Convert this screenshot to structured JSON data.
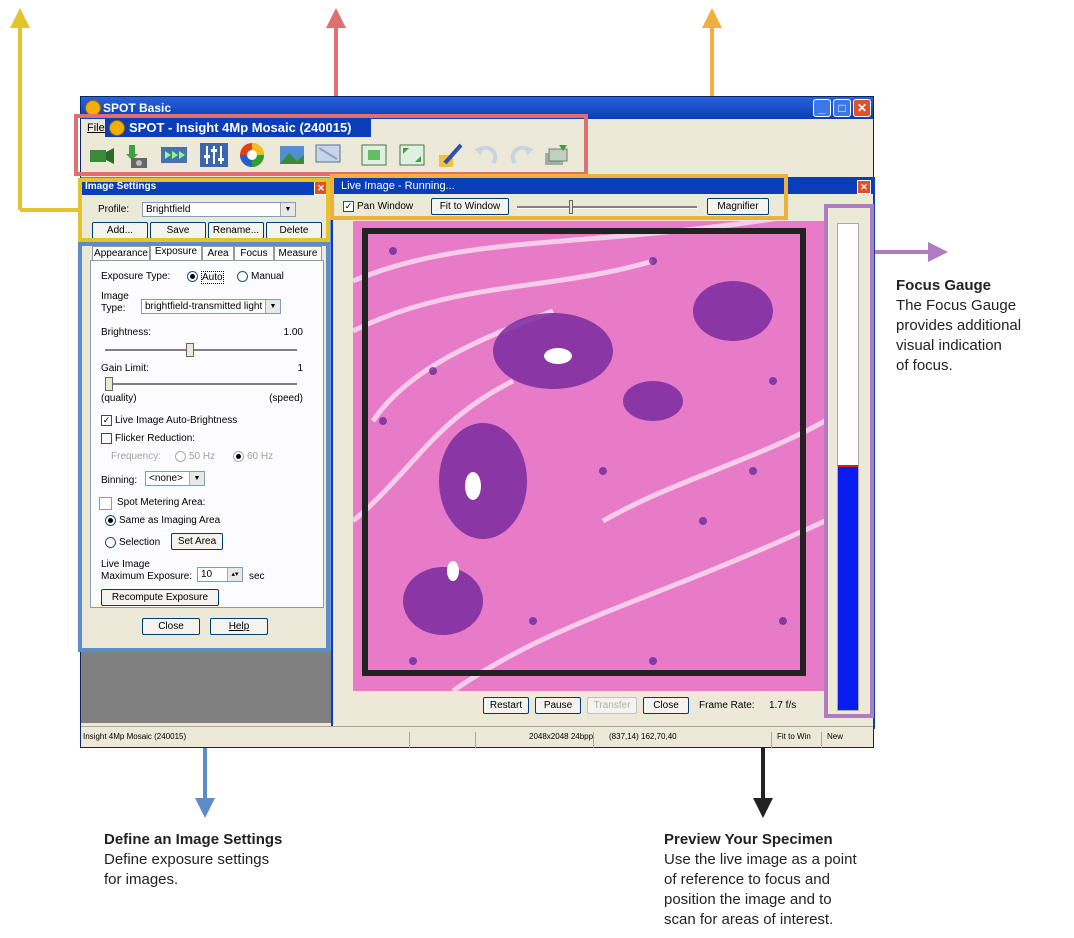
{
  "window": {
    "app_title": "SPOT Basic",
    "menu_file": "File",
    "doc_title": "SPOT - Insight 4Mp Mosaic (240015)",
    "minimize": "_",
    "maximize": "□",
    "close": "✕"
  },
  "toolbar": {
    "icons": [
      "video-camera-icon",
      "download-camera-icon",
      "filmstrip-icon",
      "sliders-icon",
      "color-wheel-icon",
      "image-icon",
      "monitor-icon",
      "fit-icon",
      "fullscreen-icon",
      "edit-icon",
      "undo-icon",
      "redo-icon",
      "stack-icon"
    ]
  },
  "image_settings": {
    "title": "Image Settings",
    "profile_label": "Profile:",
    "profile_value": "Brightfield",
    "buttons": [
      "Add...",
      "Save",
      "Rename...",
      "Delete"
    ],
    "tabs": [
      "Appearance",
      "Exposure",
      "Area",
      "Focus",
      "Measure"
    ],
    "exposure_type_label": "Exposure Type:",
    "exposure_auto": "Auto",
    "exposure_manual": "Manual",
    "image_type_label": "Image",
    "image_type_label2": "Type:",
    "image_type_value": "brightfield-transmitted light",
    "brightness_label": "Brightness:",
    "brightness_value": "1.00",
    "brightness_level": 0.5,
    "gain_label": "Gain Limit:",
    "gain_value": "1",
    "gain_level": 0.0,
    "gain_left": "(quality)",
    "gain_right": "(speed)",
    "live_auto_brightness": "Live Image Auto-Brightness",
    "flicker_reduction": "Flicker Reduction:",
    "frequency_label": "Frequency:",
    "freq_50": "50 Hz",
    "freq_60": "60 Hz",
    "binning_label": "Binning:",
    "binning_value": "<none>",
    "spot_metering": "Spot Metering Area:",
    "same_as_imaging": "Same as Imaging Area",
    "selection": "Selection",
    "set_area": "Set Area",
    "live_image_label": "Live Image",
    "max_exposure_label": "Maximum Exposure:",
    "max_exposure_value": "10",
    "max_exposure_unit": "sec",
    "recompute": "Recompute Exposure",
    "close": "Close",
    "help": "Help"
  },
  "live_image": {
    "title": "Live Image - Running...",
    "pan_window": "Pan Window",
    "fit_to_window": "Fit to Window",
    "magnifier": "Magnifier",
    "restart": "Restart",
    "pause": "Pause",
    "transfer": "Transfer",
    "close": "Close",
    "frame_rate_label": "Frame Rate:",
    "frame_rate_value": "1.7 f/s",
    "focus_level": 0.5
  },
  "status_bar": {
    "camera": "Insight 4Mp Mosaic (240015)",
    "dimensions": "2048x2048 24bpp",
    "coords": "(837,14) 162,70,40",
    "fit": "Fit to Win",
    "state": "New"
  },
  "annotations": {
    "focus_title": "Focus Gauge",
    "focus_body": [
      "The Focus Gauge",
      "provides additional",
      "visual indication",
      "of focus."
    ],
    "settings_title": "Define an Image Settings",
    "settings_body": [
      "Define exposure settings",
      "for images."
    ],
    "preview_title": "Preview Your Specimen",
    "preview_body": [
      "Use the live image as a point",
      "of reference to focus and",
      "position the image and to",
      "scan for areas of interest."
    ]
  },
  "colors": {
    "yellow": "#e4c42c",
    "red": "#e07070",
    "orange": "#f0b040",
    "purple": "#b07cc0",
    "blue": "#5b8dc8",
    "black": "#222222",
    "focus_fill": "#0a1cf0"
  }
}
